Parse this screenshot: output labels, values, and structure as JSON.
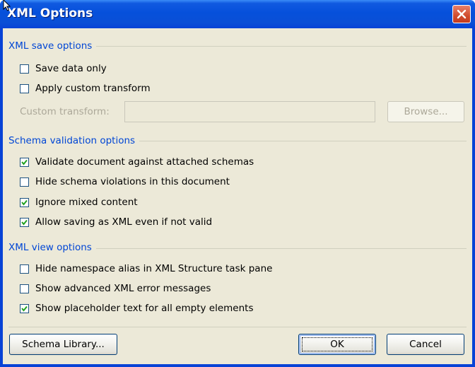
{
  "window": {
    "title": "XML Options"
  },
  "sections": {
    "save": {
      "title": "XML save options"
    },
    "schema": {
      "title": "Schema validation options"
    },
    "view": {
      "title": "XML view options"
    }
  },
  "checkboxes": [
    {
      "label": "Save data only",
      "checked": false
    },
    {
      "label": "Apply custom transform",
      "checked": false
    },
    {
      "label": "Validate document against attached schemas",
      "checked": true
    },
    {
      "label": "Hide schema violations in this document",
      "checked": false
    },
    {
      "label": "Ignore mixed content",
      "checked": true
    },
    {
      "label": "Allow saving as XML even if not valid",
      "checked": true
    },
    {
      "label": "Hide namespace alias in XML Structure task pane",
      "checked": false
    },
    {
      "label": "Show advanced XML error messages",
      "checked": false
    },
    {
      "label": "Show placeholder text for all empty elements",
      "checked": true
    }
  ],
  "custom_transform": {
    "label": "Custom transform:",
    "value": "",
    "browse_label": "Browse..."
  },
  "buttons": {
    "schema_library": "Schema Library...",
    "ok": "OK",
    "cancel": "Cancel"
  }
}
